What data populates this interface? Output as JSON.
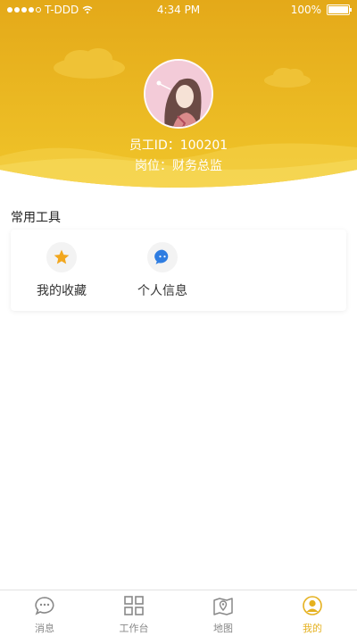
{
  "status_bar": {
    "carrier": "T-DDD",
    "time": "4:34 PM",
    "battery": "100%",
    "battery_level": 1.0
  },
  "profile": {
    "employee_id": "员工ID：100201",
    "position": "岗位：财务总监"
  },
  "tools": {
    "section_title": "常用工具",
    "items": [
      {
        "label": "我的收藏",
        "icon": "star-icon",
        "color": "#f2a71e"
      },
      {
        "label": "个人信息",
        "icon": "chat-bubble-icon",
        "color": "#2f7de1"
      }
    ]
  },
  "tabbar": {
    "items": [
      {
        "label": "消息",
        "icon": "message-icon",
        "active": false
      },
      {
        "label": "工作台",
        "icon": "grid-icon",
        "active": false
      },
      {
        "label": "地图",
        "icon": "map-icon",
        "active": false
      },
      {
        "label": "我的",
        "icon": "user-icon",
        "active": true
      }
    ]
  },
  "colors": {
    "header_yellow": "#e7b01c",
    "accent": "#e5b11f",
    "inactive_tab": "#888888"
  }
}
